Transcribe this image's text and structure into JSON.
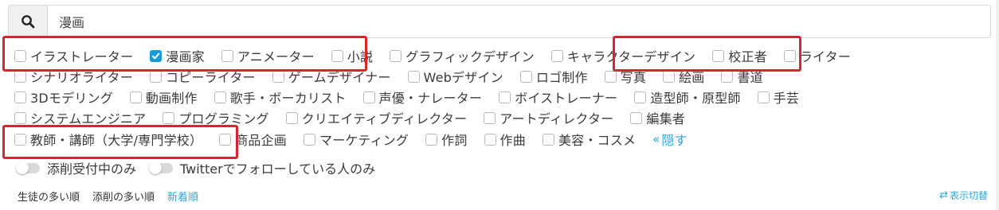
{
  "search": {
    "value": "漫画",
    "placeholder": ""
  },
  "categories": {
    "row1": [
      {
        "label": "イラストレーター",
        "checked": false
      },
      {
        "label": "漫画家",
        "checked": true
      },
      {
        "label": "アニメーター",
        "checked": false
      },
      {
        "label": "小説",
        "checked": false
      },
      {
        "label": "グラフィックデザイン",
        "checked": false
      },
      {
        "label": "キャラクターデザイン",
        "checked": false
      },
      {
        "label": "校正者",
        "checked": false
      },
      {
        "label": "ライター",
        "checked": false
      }
    ],
    "row2": [
      {
        "label": "シナリオライター",
        "checked": false
      },
      {
        "label": "コピーライター",
        "checked": false
      },
      {
        "label": "ゲームデザイナー",
        "checked": false
      },
      {
        "label": "Webデザイン",
        "checked": false
      },
      {
        "label": "ロゴ制作",
        "checked": false
      },
      {
        "label": "写真",
        "checked": false
      },
      {
        "label": "絵画",
        "checked": false
      },
      {
        "label": "書道",
        "checked": false
      }
    ],
    "row3": [
      {
        "label": "3Dモデリング",
        "checked": false
      },
      {
        "label": "動画制作",
        "checked": false
      },
      {
        "label": "歌手・ボーカリスト",
        "checked": false
      },
      {
        "label": "声優・ナレーター",
        "checked": false
      },
      {
        "label": "ボイストレーナー",
        "checked": false
      },
      {
        "label": "造型師・原型師",
        "checked": false
      },
      {
        "label": "手芸",
        "checked": false
      }
    ],
    "row4": [
      {
        "label": "システムエンジニア",
        "checked": false
      },
      {
        "label": "プログラミング",
        "checked": false
      },
      {
        "label": "クリエイティブディレクター",
        "checked": false
      },
      {
        "label": "アートディレクター",
        "checked": false
      },
      {
        "label": "編集者",
        "checked": false
      }
    ],
    "row5": [
      {
        "label": "教師・講師（大学/専門学校）",
        "checked": false
      },
      {
        "label": "商品企画",
        "checked": false
      },
      {
        "label": "マーケティング",
        "checked": false
      },
      {
        "label": "作詞",
        "checked": false
      },
      {
        "label": "作曲",
        "checked": false
      },
      {
        "label": "美容・コスメ",
        "checked": false
      }
    ],
    "hide_label": "隠す",
    "hide_icon": "double-chevron-left-icon"
  },
  "toggles": [
    {
      "label": "添削受付中のみ",
      "on": false
    },
    {
      "label": "Twitterでフォローしている人のみ",
      "on": false
    }
  ],
  "sort": {
    "options": [
      {
        "label": "生徒の多い順",
        "active": false
      },
      {
        "label": "添削の多い順",
        "active": false
      },
      {
        "label": "新着順",
        "active": true
      }
    ]
  },
  "view_toggle": {
    "label": "表示切替",
    "icon": "swap-arrows-icon"
  },
  "colors": {
    "accent": "#2ca5dd",
    "checkbox_checked": "#1a9ad6",
    "highlight_border": "#d4262c",
    "text": "#3a3a3a"
  }
}
